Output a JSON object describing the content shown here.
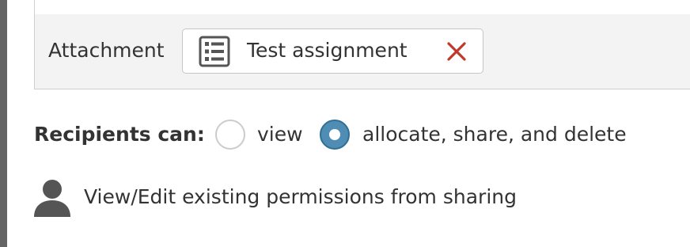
{
  "attachment": {
    "label": "Attachment",
    "chip": {
      "icon": "list-document-icon",
      "name": "Test assignment",
      "remove_icon": "close-x-icon",
      "remove_color": "#c0392b"
    }
  },
  "recipients": {
    "label": "Recipients can:",
    "options": [
      {
        "label": "view",
        "selected": false
      },
      {
        "label": "allocate, share, and delete",
        "selected": true
      }
    ],
    "selected_color": "#4f8db4"
  },
  "permissions": {
    "icon": "person-icon",
    "link_text": "View/Edit existing permissions from sharing"
  }
}
